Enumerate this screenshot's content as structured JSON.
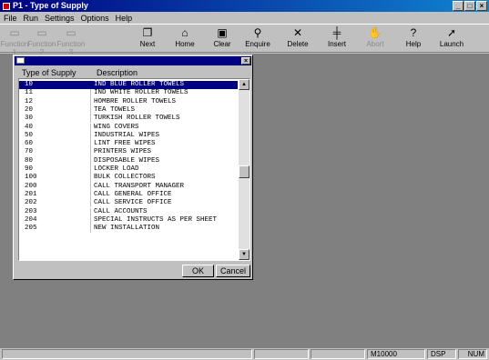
{
  "window": {
    "title": "P1 - Type of Supply",
    "buttons": [
      "_",
      "□",
      "×"
    ]
  },
  "menu": [
    "File",
    "Run",
    "Settings",
    "Options",
    "Help"
  ],
  "toolbar": [
    {
      "label": "Function 1",
      "icon": "function1-icon",
      "glyph": "▭",
      "enabled": false
    },
    {
      "label": "Function 2",
      "icon": "function2-icon",
      "glyph": "▭",
      "enabled": false
    },
    {
      "label": "Function 3",
      "icon": "function3-icon",
      "glyph": "▭",
      "enabled": false
    },
    {
      "label": "Next",
      "icon": "next-page-icon",
      "glyph": "❐",
      "enabled": true
    },
    {
      "label": "Home",
      "icon": "home-icon",
      "glyph": "⌂",
      "enabled": true
    },
    {
      "label": "Clear",
      "icon": "clear-icon",
      "glyph": "▣",
      "enabled": true
    },
    {
      "label": "Enquire",
      "icon": "magnifier-icon",
      "glyph": "⚲",
      "enabled": true
    },
    {
      "label": "Delete",
      "icon": "delete-icon",
      "glyph": "✕",
      "enabled": true
    },
    {
      "label": "Insert",
      "icon": "insert-icon",
      "glyph": "╪",
      "enabled": true
    },
    {
      "label": "Abort",
      "icon": "abort-icon",
      "glyph": "✋",
      "enabled": false
    },
    {
      "label": "Help",
      "icon": "help-icon",
      "glyph": "?",
      "enabled": true
    },
    {
      "label": "Launch",
      "icon": "launch-icon",
      "glyph": "➚",
      "enabled": true
    }
  ],
  "dialog": {
    "close_glyph": "×",
    "columns": [
      "Type of Supply",
      "Description"
    ],
    "rows": [
      {
        "code": "10",
        "desc": "IND BLUE ROLLER TOWELS",
        "selected": true
      },
      {
        "code": "11",
        "desc": "IND WHITE ROLLER TOWELS"
      },
      {
        "code": "12",
        "desc": "HOMBRE ROLLER TOWELS"
      },
      {
        "code": "20",
        "desc": "TEA TOWELS"
      },
      {
        "code": "30",
        "desc": "TURKISH ROLLER TOWELS"
      },
      {
        "code": "40",
        "desc": "WING COVERS"
      },
      {
        "code": "50",
        "desc": "INDUSTRIAL WIPES"
      },
      {
        "code": "60",
        "desc": "LINT FREE WIPES"
      },
      {
        "code": "70",
        "desc": "PRINTERS WIPES"
      },
      {
        "code": "80",
        "desc": "DISPOSABLE WIPES"
      },
      {
        "code": "90",
        "desc": "LOCKER LOAD"
      },
      {
        "code": "100",
        "desc": "BULK COLLECTORS"
      },
      {
        "code": "200",
        "desc": "CALL TRANSPORT MANAGER"
      },
      {
        "code": "201",
        "desc": "CALL GENERAL OFFICE"
      },
      {
        "code": "202",
        "desc": "CALL SERVICE OFFICE"
      },
      {
        "code": "203",
        "desc": "CALL ACCOUNTS"
      },
      {
        "code": "204",
        "desc": "SPECIAL INSTRUCTS AS PER SHEET"
      },
      {
        "code": "205",
        "desc": "NEW INSTALLATION"
      }
    ],
    "scroll_up": "▲",
    "scroll_down": "▼",
    "ok_label": "OK",
    "cancel_label": "Cancel"
  },
  "status": {
    "code": "M10000",
    "mode": "DSP",
    "num": "NUM"
  }
}
